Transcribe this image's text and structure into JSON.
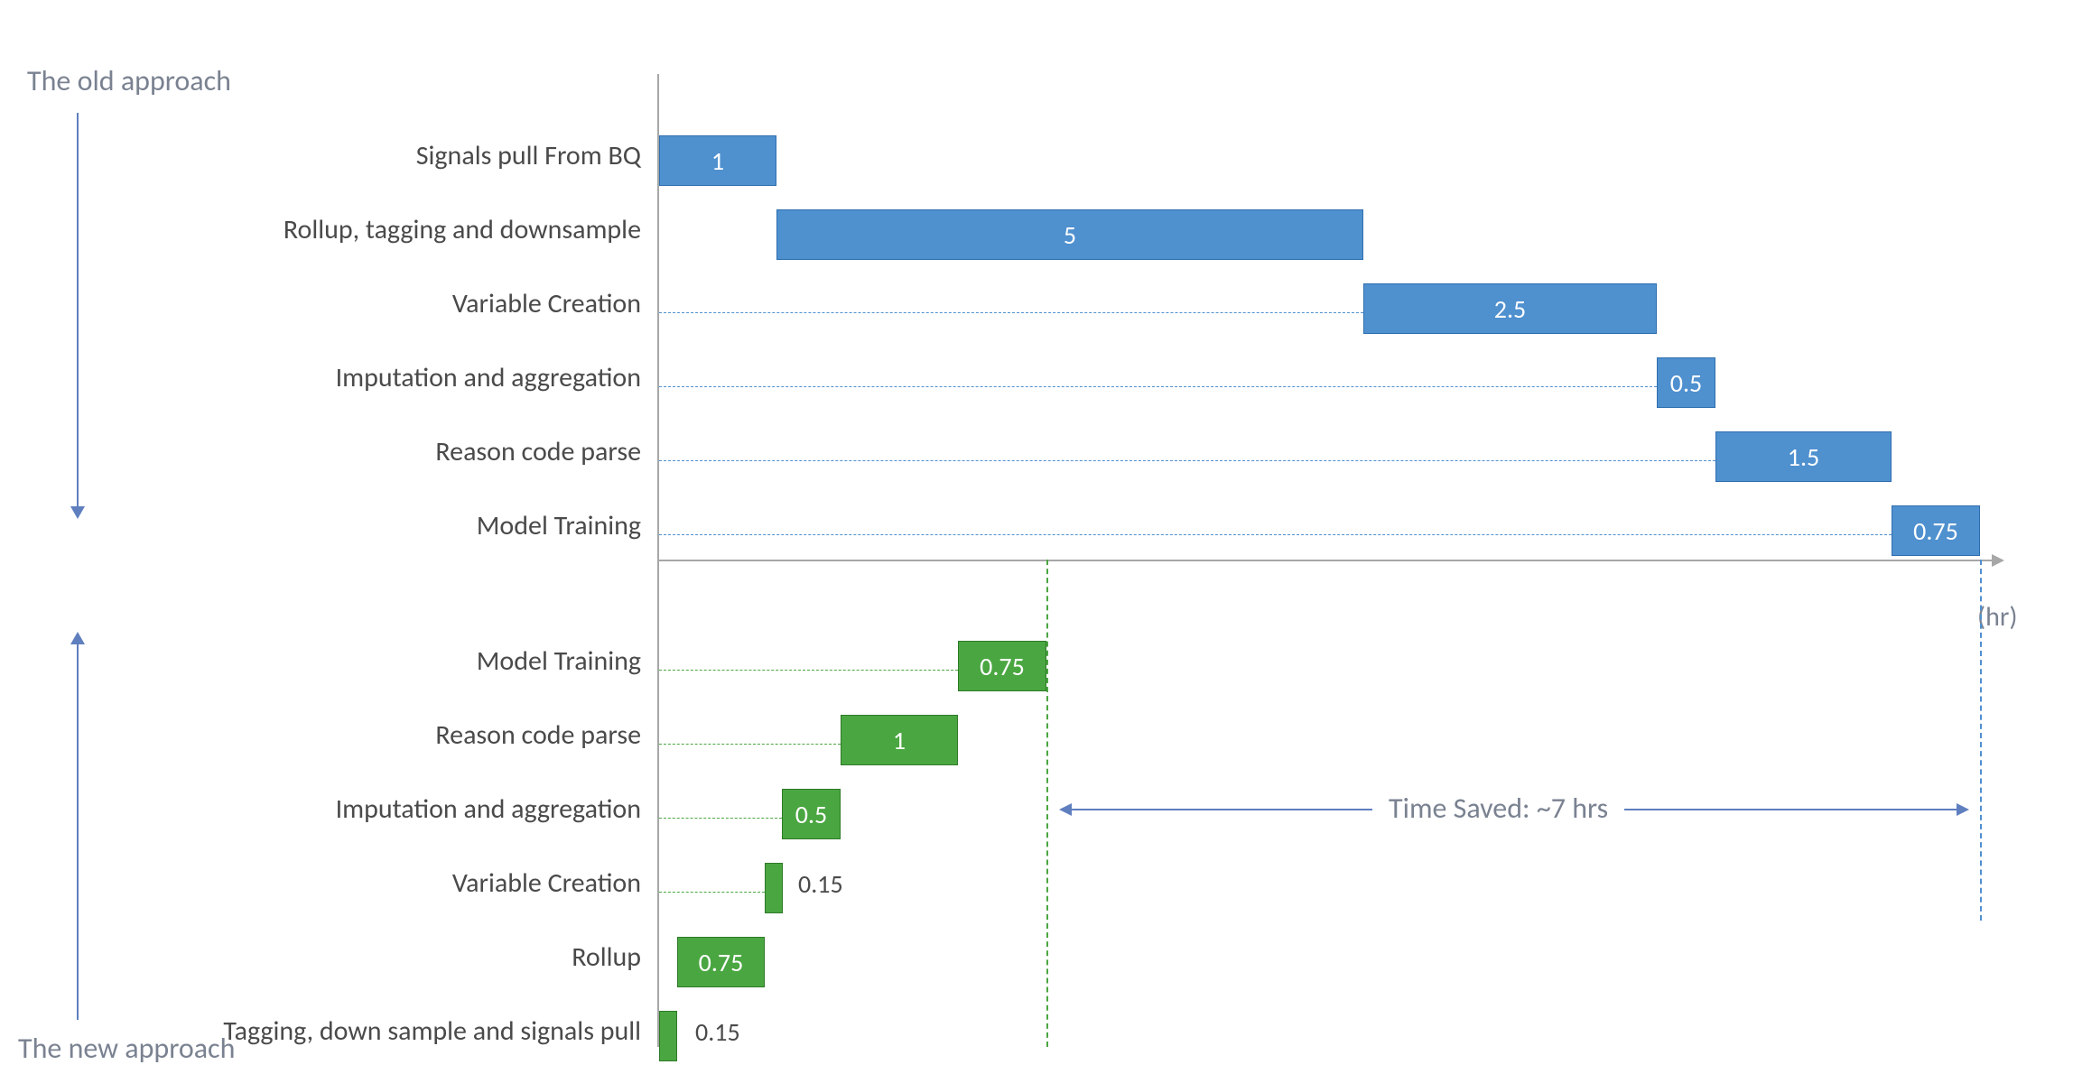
{
  "labels": {
    "old_approach": "The old approach",
    "new_approach": "The new approach",
    "hr": "(hr)",
    "time_saved": "Time Saved: ~7 hrs"
  },
  "old": {
    "rows": [
      {
        "label": "Signals pull From BQ",
        "value": "1"
      },
      {
        "label": "Rollup, tagging and downsample",
        "value": "5"
      },
      {
        "label": "Variable Creation",
        "value": "2.5"
      },
      {
        "label": "Imputation and aggregation",
        "value": "0.5"
      },
      {
        "label": "Reason code parse",
        "value": "1.5"
      },
      {
        "label": "Model Training",
        "value": "0.75"
      }
    ]
  },
  "new": {
    "rows": [
      {
        "label": "Model Training",
        "value": "0.75"
      },
      {
        "label": "Reason code parse",
        "value": "1"
      },
      {
        "label": "Imputation and aggregation",
        "value": "0.5"
      },
      {
        "label": "Variable Creation",
        "value": "0.15"
      },
      {
        "label": "Rollup",
        "value": "0.75"
      },
      {
        "label": "Tagging, down sample and signals pull",
        "value": "0.15"
      }
    ]
  },
  "chart_data": {
    "type": "bar",
    "title": "",
    "xlabel": "(hr)",
    "ylabel": "",
    "xlim": [
      0,
      11.25
    ],
    "series": [
      {
        "name": "The old approach",
        "items": [
          {
            "task": "Signals pull From BQ",
            "start": 0,
            "duration": 1
          },
          {
            "task": "Rollup, tagging and downsample",
            "start": 1,
            "duration": 5
          },
          {
            "task": "Variable Creation",
            "start": 6,
            "duration": 2.5
          },
          {
            "task": "Imputation and aggregation",
            "start": 8.5,
            "duration": 0.5
          },
          {
            "task": "Reason code parse",
            "start": 9,
            "duration": 1.5
          },
          {
            "task": "Model Training",
            "start": 10.5,
            "duration": 0.75
          }
        ],
        "total_hours": 11.25
      },
      {
        "name": "The new approach",
        "items": [
          {
            "task": "Tagging, down sample and signals pull",
            "start": 0,
            "duration": 0.15
          },
          {
            "task": "Rollup",
            "start": 0.15,
            "duration": 0.75
          },
          {
            "task": "Variable Creation",
            "start": 0.9,
            "duration": 0.15
          },
          {
            "task": "Imputation and aggregation",
            "start": 1.05,
            "duration": 0.5
          },
          {
            "task": "Reason code parse",
            "start": 1.55,
            "duration": 1
          },
          {
            "task": "Model Training",
            "start": 2.55,
            "duration": 0.75
          }
        ],
        "total_hours": 3.3
      }
    ],
    "annotation": {
      "text": "Time Saved: ~7 hrs",
      "value_hours": 7
    }
  }
}
